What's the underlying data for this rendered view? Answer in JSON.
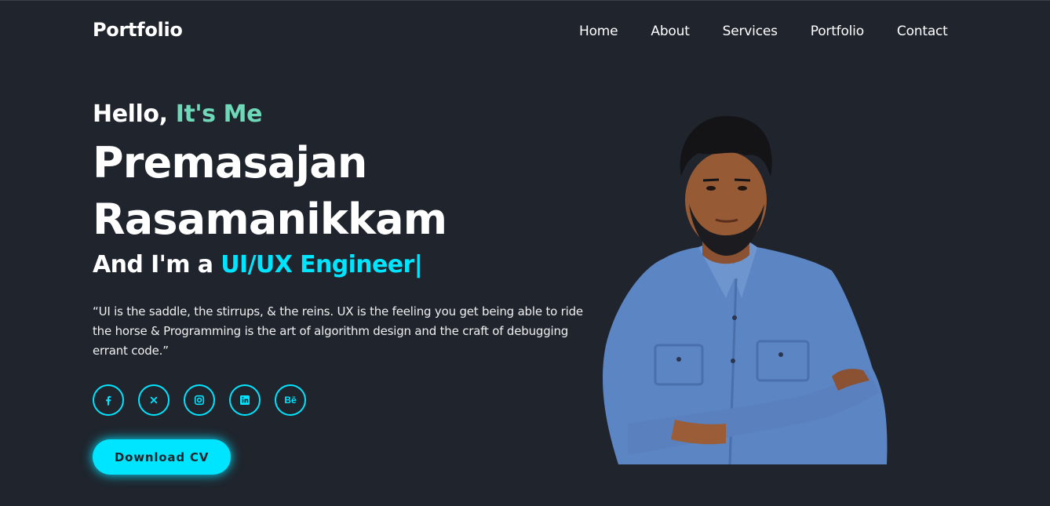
{
  "header": {
    "logo": "Portfolio",
    "nav": [
      "Home",
      "About",
      "Services",
      "Portfolio",
      "Contact"
    ]
  },
  "hero": {
    "greeting": "Hello,",
    "greeting_accent": "It's Me",
    "name_line1": "Premasajan",
    "name_line2": "Rasamanikkam",
    "role_prefix": "And I'm a",
    "role_typed": "UI/UX Engineer|",
    "quote": "“UI is the saddle, the stirrups, & the reins. UX is the feeling you get being able to ride the horse & Programming is the art of algorithm design and the craft of debugging errant code.”",
    "cta_label": "Download CV"
  },
  "socials": [
    {
      "icon": "facebook-icon"
    },
    {
      "icon": "x-icon"
    },
    {
      "icon": "instagram-icon"
    },
    {
      "icon": "linkedin-icon"
    },
    {
      "icon": "behance-icon",
      "text": "Bē"
    }
  ],
  "colors": {
    "background": "#1f242d",
    "accent_cyan": "#00e5ff",
    "accent_green": "#6fd8b8",
    "text": "#ffffff"
  }
}
